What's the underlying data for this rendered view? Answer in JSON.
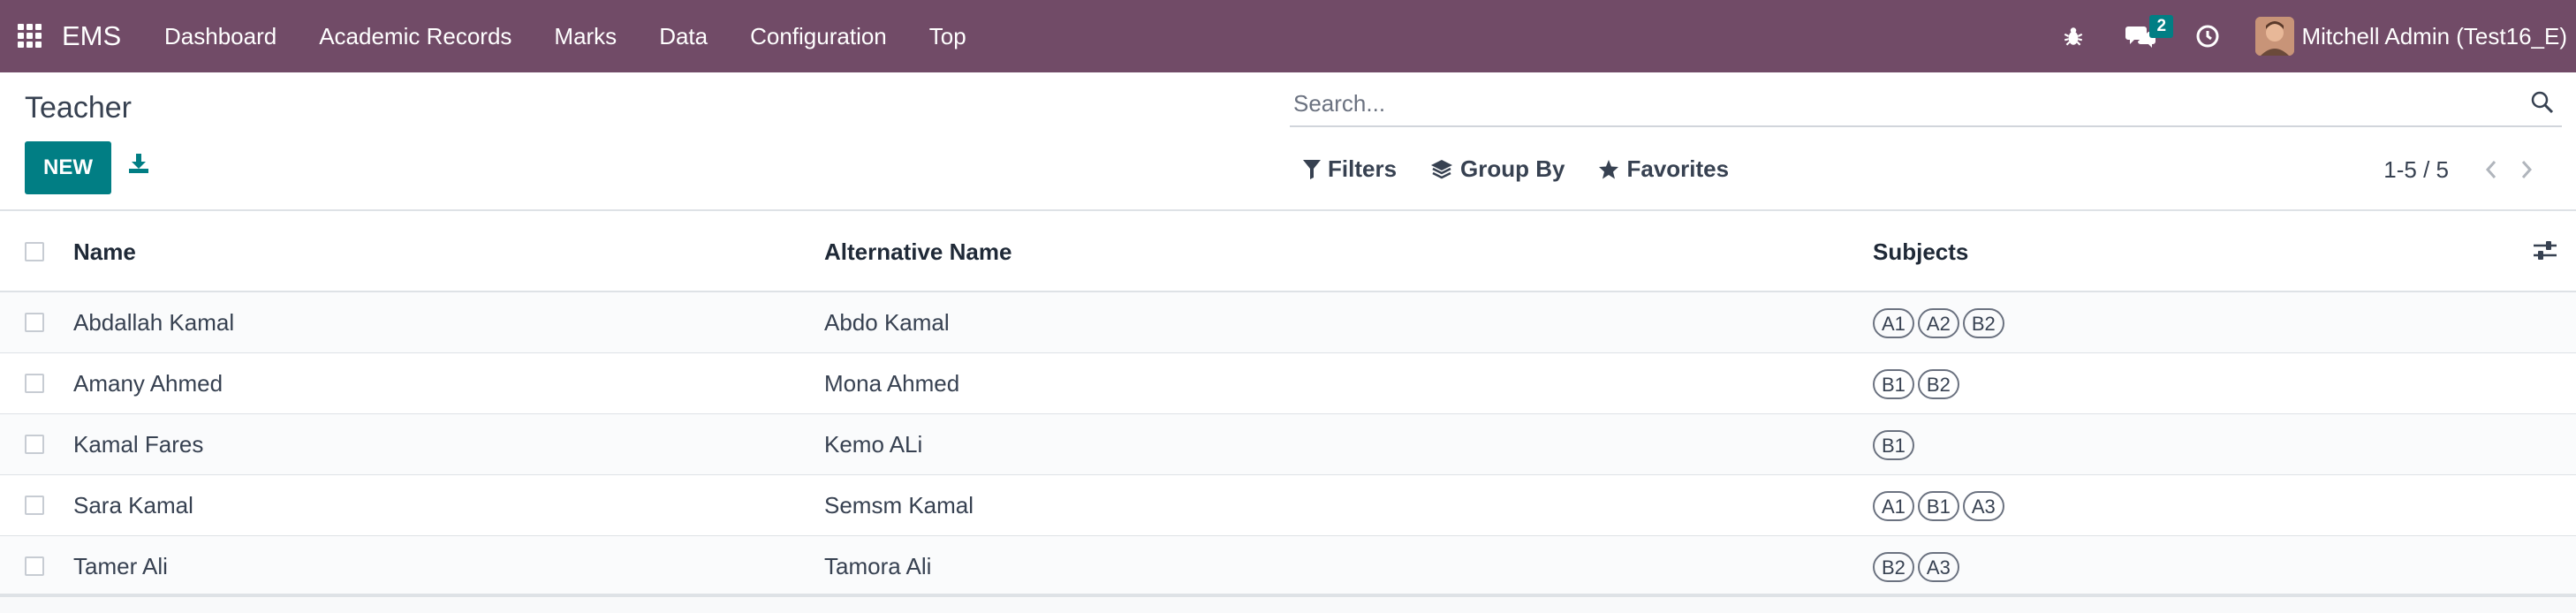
{
  "navbar": {
    "brand": "EMS",
    "menu": [
      "Dashboard",
      "Academic Records",
      "Marks",
      "Data",
      "Configuration",
      "Top"
    ],
    "messages_count": "2",
    "user_name": "Mitchell Admin (Test16_E)",
    "icons": [
      "apps-grid-icon",
      "bug-icon",
      "chat-icon",
      "clock-icon"
    ]
  },
  "page": {
    "title": "Teacher",
    "new_label": "NEW"
  },
  "search": {
    "placeholder": "Search..."
  },
  "filters": {
    "filters_label": "Filters",
    "group_by_label": "Group By",
    "favorites_label": "Favorites"
  },
  "pager": {
    "value": "1-5 / 5"
  },
  "table": {
    "columns": [
      "Name",
      "Alternative Name",
      "Subjects"
    ],
    "rows": [
      {
        "name": "Abdallah Kamal",
        "alt_name": "Abdo Kamal",
        "subjects": [
          "A1",
          "A2",
          "B2"
        ]
      },
      {
        "name": "Amany Ahmed",
        "alt_name": "Mona Ahmed",
        "subjects": [
          "B1",
          "B2"
        ]
      },
      {
        "name": "Kamal Fares",
        "alt_name": "Kemo ALi",
        "subjects": [
          "B1"
        ]
      },
      {
        "name": "Sara Kamal",
        "alt_name": "Semsm Kamal",
        "subjects": [
          "A1",
          "B1",
          "A3"
        ]
      },
      {
        "name": "Tamer Ali",
        "alt_name": "Tamora Ali",
        "subjects": [
          "B2",
          "A3"
        ]
      }
    ]
  },
  "colors": {
    "navbar": "#714B67",
    "primary": "#017e84"
  }
}
